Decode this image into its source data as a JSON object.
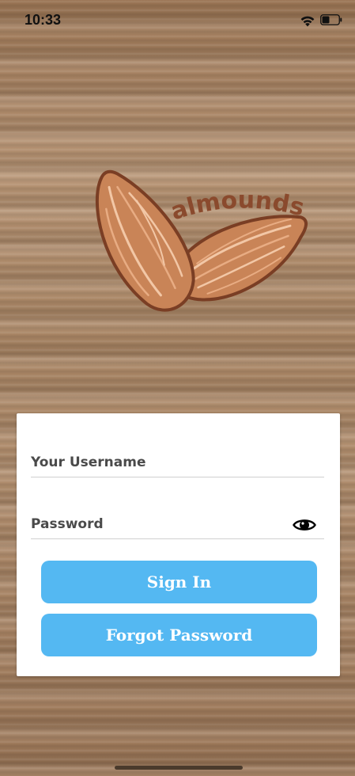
{
  "status_bar": {
    "time": "10:33",
    "icons": [
      "wifi-icon",
      "battery-icon"
    ]
  },
  "logo": {
    "brand_text": "almounds",
    "colors": {
      "almond_fill": "#c98457",
      "almond_outline": "#7a3e24",
      "almond_streak": "#f2c7a6",
      "brand_text": "#8a4a2d"
    }
  },
  "login": {
    "username_label": "Your Username",
    "password_label": "Password",
    "show_password_icon": "eye-icon",
    "sign_in_label": "Sign In",
    "forgot_password_label": "Forgot Password"
  },
  "colors": {
    "button_bg": "#54b8f2",
    "button_text": "#ffffff",
    "card_bg": "#ffffff",
    "label_text": "#4a4a4a"
  }
}
